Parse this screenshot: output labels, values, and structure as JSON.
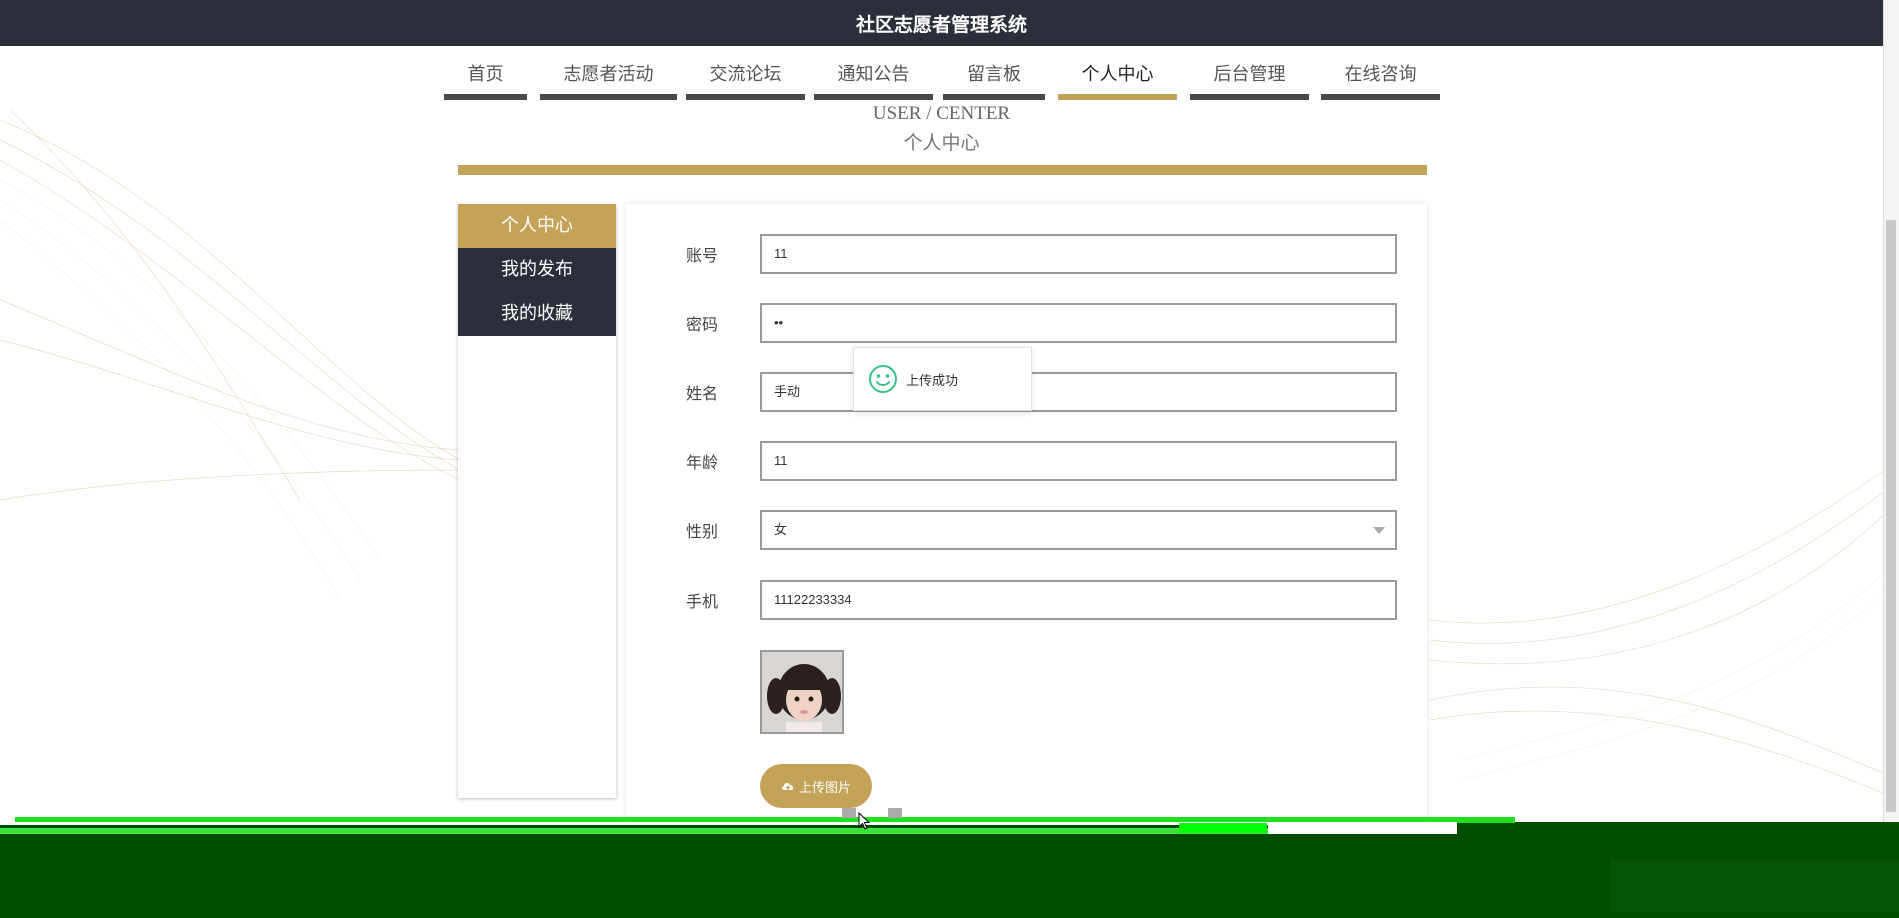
{
  "header": {
    "title": "社区志愿者管理系统"
  },
  "nav": {
    "items": [
      {
        "label": "首页"
      },
      {
        "label": "志愿者活动"
      },
      {
        "label": "交流论坛"
      },
      {
        "label": "通知公告"
      },
      {
        "label": "留言板"
      },
      {
        "label": "个人中心",
        "active": true
      },
      {
        "label": "后台管理"
      },
      {
        "label": "在线咨询"
      }
    ]
  },
  "page": {
    "breadcrumb_en": "USER / CENTER",
    "breadcrumb_cn": "个人中心"
  },
  "sidebar": {
    "items": [
      {
        "label": "个人中心",
        "active": true
      },
      {
        "label": "我的发布"
      },
      {
        "label": "我的收藏"
      }
    ]
  },
  "form": {
    "account": {
      "label": "账号",
      "value": "11"
    },
    "password": {
      "label": "密码",
      "value": "••"
    },
    "name": {
      "label": "姓名",
      "value": "手动"
    },
    "age": {
      "label": "年龄",
      "value": "11"
    },
    "gender": {
      "label": "性别",
      "value": "女"
    },
    "phone": {
      "label": "手机",
      "value": "11122233334"
    },
    "upload_label": "上传图片"
  },
  "toast": {
    "text": "上传成功"
  },
  "colors": {
    "gold": "#c4a257",
    "dark": "#2b2f3a",
    "toast_icon": "#3bbf8a"
  }
}
